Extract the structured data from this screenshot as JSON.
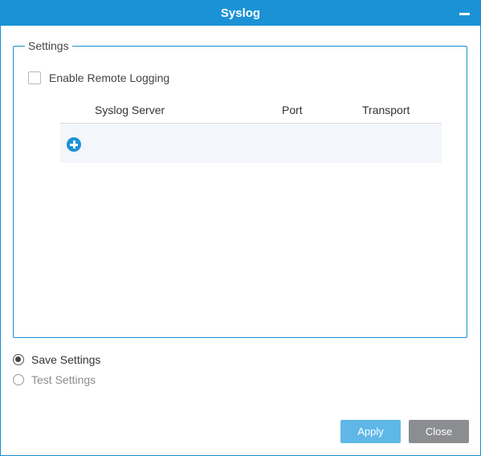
{
  "window": {
    "title": "Syslog"
  },
  "settings": {
    "legend": "Settings",
    "enable_remote_logging": {
      "label": "Enable Remote Logging",
      "checked": false
    },
    "table": {
      "columns": [
        "Syslog Server",
        "Port",
        "Transport"
      ],
      "rows": []
    }
  },
  "mode": {
    "options": [
      {
        "label": "Save Settings",
        "selected": true,
        "enabled": true
      },
      {
        "label": "Test Settings",
        "selected": false,
        "enabled": false
      }
    ]
  },
  "buttons": {
    "apply_label": "Apply",
    "close_label": "Close"
  },
  "colors": {
    "accent": "#1b92d6",
    "apply": "#5eb7e6",
    "close": "#8c8d90"
  },
  "icons": {
    "minimize": "minimize-icon",
    "add": "plus-circle-icon"
  }
}
